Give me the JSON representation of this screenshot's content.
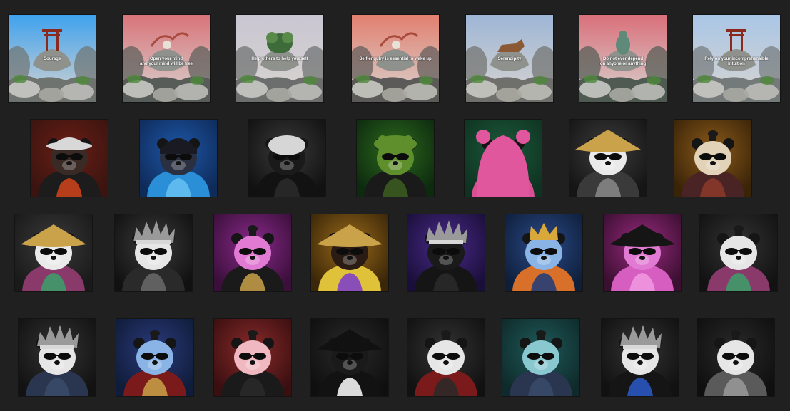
{
  "page": {
    "background": "#202020"
  },
  "cards": [
    {
      "caption": "Courage",
      "sky": "#3fa2ee",
      "accent": "#8a2a1c",
      "icon": "torii-gate-icon",
      "ground": "#6f7370"
    },
    {
      "caption": "Open your mind\nand your mind will be free",
      "sky": "#d9747a",
      "accent": "#a84b3d",
      "icon": "dragon-icon",
      "ground": "#575c59"
    },
    {
      "caption": "Help others to help yourself",
      "sky": "#c9c6d2",
      "accent": "#3d6b3a",
      "icon": "bamboo-icon",
      "ground": "#6b6e6d"
    },
    {
      "caption": "Self-enquiry is essential to wake up",
      "sky": "#e28070",
      "accent": "#a84b3d",
      "icon": "dragon-icon",
      "ground": "#5c5a58"
    },
    {
      "caption": "Serendipity",
      "sky": "#9eb6d6",
      "accent": "#8b5a34",
      "icon": "fox-icon",
      "ground": "#6f706c"
    },
    {
      "caption": "Do not ever depend\non anyone or anything",
      "sky": "#d9707a",
      "accent": "#5f8a79",
      "icon": "jade-statue-icon",
      "ground": "#4e5a52"
    },
    {
      "caption": "Rely on your incomprehensible\nintuition",
      "sky": "#a9c6e6",
      "accent": "#8a2a1c",
      "icon": "torii-gate-icon",
      "ground": "#74797a"
    }
  ],
  "avatars_row2": [
    {
      "bg": "#3b1410",
      "glow": "#6a1e14",
      "hat": "bucket-hat",
      "hat_color": "#d8d8d8",
      "face": "#3a2a26",
      "body": "#1c1c1c",
      "patch": "#d2441a"
    },
    {
      "bg": "#0f2b5a",
      "glow": "#1d57a8",
      "hat": "beanie",
      "hat_color": "#1a1a22",
      "face": "#2a3040",
      "body": "#2a8fd6",
      "patch": "#67c2f2"
    },
    {
      "bg": "#111111",
      "glow": "#3a3a3a",
      "hat": "fur-hood",
      "hat_color": "#d6d6d6",
      "face": "#1a1a1a",
      "body": "#121212",
      "patch": "#2b2b2b"
    },
    {
      "bg": "#0d2a0f",
      "glow": "#2d6a1d",
      "hat": "moss",
      "hat_color": "#5f8f2c",
      "face": "#5f8f2c",
      "body": "#1a1a1a",
      "patch": "#3d5e22"
    },
    {
      "bg": "#0f3322",
      "glow": "#1c5a3a",
      "hat": "bear-hood",
      "hat_color": "#e0579d",
      "face": "#3fa07e",
      "body": "#d94f93",
      "patch": "#f29ac7"
    },
    {
      "bg": "#151515",
      "glow": "#3d3d3d",
      "hat": "straw-hat",
      "hat_color": "#c9a24a",
      "face": "#eaeaea",
      "body": "#3a3a3a",
      "patch": "#8a8a8a"
    },
    {
      "bg": "#3a2408",
      "glow": "#8b5a1a",
      "hat": "topknot",
      "hat_color": "#1a1a1a",
      "face": "#e2d2b8",
      "body": "#4a2424",
      "patch": "#8b3a2a"
    }
  ],
  "avatars_row3": [
    {
      "bg": "#1a1a1a",
      "glow": "#3a3a3a",
      "hat": "straw-hat",
      "hat_color": "#c9a24a",
      "face": "#eaeaea",
      "body": "#8a3a6a",
      "patch": "#3aa06a"
    },
    {
      "bg": "#111111",
      "glow": "#3a3a3a",
      "hat": "spiky",
      "hat_color": "#9a9a9a",
      "face": "#e6e6e6",
      "body": "#2a2a2a",
      "patch": "#6a6a6a"
    },
    {
      "bg": "#3a0f3a",
      "glow": "#8a2a8a",
      "hat": "topknot",
      "hat_color": "#1a1a1a",
      "face": "#e07ad2",
      "body": "#1a1a1a",
      "patch": "#c9a24a"
    },
    {
      "bg": "#3a2608",
      "glow": "#9a6a1a",
      "hat": "straw-hat",
      "hat_color": "#c9a24a",
      "face": "#2a1c14",
      "body": "#e0c23a",
      "patch": "#7a3ad0"
    },
    {
      "bg": "#1a0f3a",
      "glow": "#4a2a8a",
      "hat": "spiky",
      "hat_color": "#9a9a9a",
      "face": "#1a1a1a",
      "body": "#151515",
      "patch": "#2a2a2a"
    },
    {
      "bg": "#0f1f3a",
      "glow": "#2a4a8a",
      "hat": "crown",
      "hat_color": "#d9a83a",
      "face": "#8ab4e6",
      "body": "#d9702a",
      "patch": "#1a3a7a"
    },
    {
      "bg": "#3a0f30",
      "glow": "#9a2a80",
      "hat": "straw-hat-dark",
      "hat_color": "#151515",
      "face": "#e07ad2",
      "body": "#d55ec0",
      "patch": "#f29ae0"
    },
    {
      "bg": "#121212",
      "glow": "#333333",
      "hat": "topknot",
      "hat_color": "#1a1a1a",
      "face": "#e6e6e6",
      "body": "#8a3a6a",
      "patch": "#3aa06a"
    }
  ],
  "avatars_row4": [
    {
      "bg": "#121212",
      "glow": "#333333",
      "hat": "spiky",
      "hat_color": "#9a9a9a",
      "face": "#e6e6e6",
      "body": "#2a3550",
      "patch": "#3a4a6a"
    },
    {
      "bg": "#0f1c3a",
      "glow": "#2a3a7a",
      "hat": "topknot",
      "hat_color": "#1a1a1a",
      "face": "#8ab4e6",
      "body": "#7a1a1a",
      "patch": "#c9a24a"
    },
    {
      "bg": "#3a0f10",
      "glow": "#8a2a2a",
      "hat": "topknot",
      "hat_color": "#1a1a1a",
      "face": "#f0b8c0",
      "body": "#1a1a1a",
      "patch": "#2a2a2a"
    },
    {
      "bg": "#0f0f0f",
      "glow": "#2a2a2a",
      "hat": "straw-hat-dark",
      "hat_color": "#111111",
      "face": "#1a1a1a",
      "body": "#121212",
      "patch": "#ffffff"
    },
    {
      "bg": "#111111",
      "glow": "#333333",
      "hat": "topknot",
      "hat_color": "#1a1a1a",
      "face": "#e6e6e6",
      "body": "#7a1a1a",
      "patch": "#2a2a2a"
    },
    {
      "bg": "#0f2a2a",
      "glow": "#1f5a5a",
      "hat": "topknot",
      "hat_color": "#1a1a1a",
      "face": "#8ac8d0",
      "body": "#2a3550",
      "patch": "#3a4a6a"
    },
    {
      "bg": "#111111",
      "glow": "#333333",
      "hat": "spiky",
      "hat_color": "#9a9a9a",
      "face": "#e6e6e6",
      "body": "#151515",
      "patch": "#2a5ac9"
    },
    {
      "bg": "#0f0f0f",
      "glow": "#2a2a2a",
      "hat": "topknot",
      "hat_color": "#1a1a1a",
      "face": "#e6e6e6",
      "body": "#5a5a5a",
      "patch": "#9a9a9a"
    }
  ]
}
